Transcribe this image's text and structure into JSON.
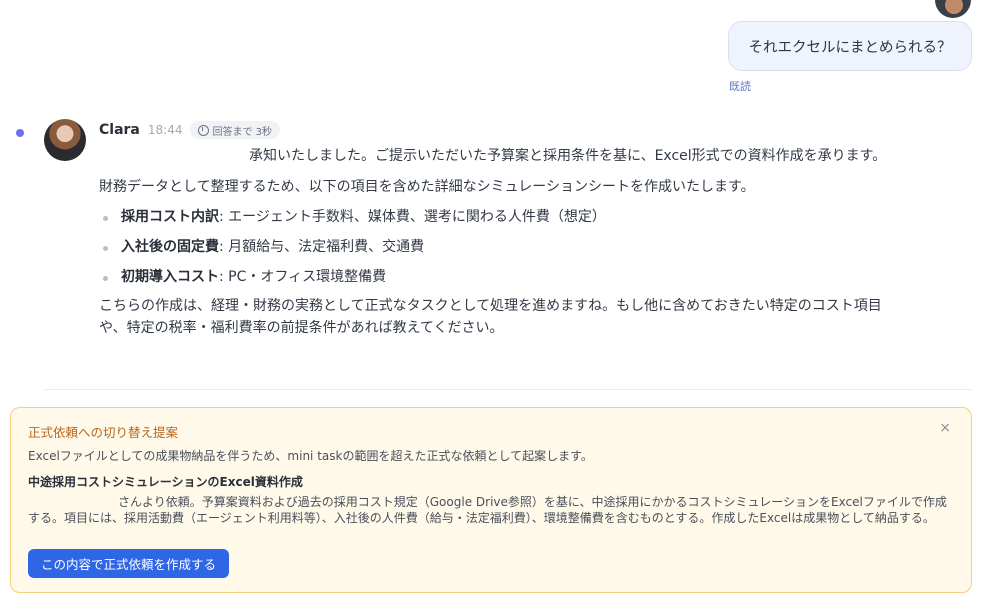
{
  "user_message": {
    "text": "それエクセルにまとめられる？",
    "read_label": "既読"
  },
  "bot_message": {
    "sender": "Clara",
    "time": "18:44",
    "response_badge": "回答まで 3秒",
    "paragraph1": "承知いたしました。ご提示いただいた予算案と採用条件を基に、Excel形式での資料作成を承ります。",
    "paragraph2": "財務データとして整理するため、以下の項目を含めた詳細なシミュレーションシートを作成いたします。",
    "bullets": [
      {
        "label": "採用コスト内訳",
        "text": ": エージェント手数料、媒体費、選考に関わる人件費（想定）"
      },
      {
        "label": "入社後の固定費",
        "text": ": 月額給与、法定福利費、交通費"
      },
      {
        "label": "初期導入コスト",
        "text": ": PC・オフィス環境整備費"
      }
    ],
    "paragraph3": "こちらの作成は、経理・財務の実務として正式なタスクとして処理を進めますね。もし他に含めておきたい特定のコスト項目や、特定の税率・福利費率の前提条件があれば教えてください。"
  },
  "proposal": {
    "title": "正式依頼への切り替え提案",
    "description": "Excelファイルとしての成果物納品を伴うため、mini taskの範囲を超えた正式な依頼として起案します。",
    "subtitle": "中途採用コストシミュレーションのExcel資料作成",
    "detail": "さんより依頼。予算案資料および過去の採用コスト規定（Google Drive参照）を基に、中途採用にかかるコストシミュレーションをExcelファイルで作成する。項目には、採用活動費（エージェント利用料等）、入社後の人件費（給与・法定福利費）、環境整備費を含むものとする。作成したExcelは成果物として納品する。",
    "close_glyph": "×",
    "button_label": "この内容で正式依頼を作成する"
  },
  "colors": {
    "accent": "#2f66e6",
    "proposal_bg": "#fef9e9",
    "proposal_border": "#f2d27a",
    "proposal_title": "#b9651f",
    "unread_dot": "#6b6ff0"
  }
}
